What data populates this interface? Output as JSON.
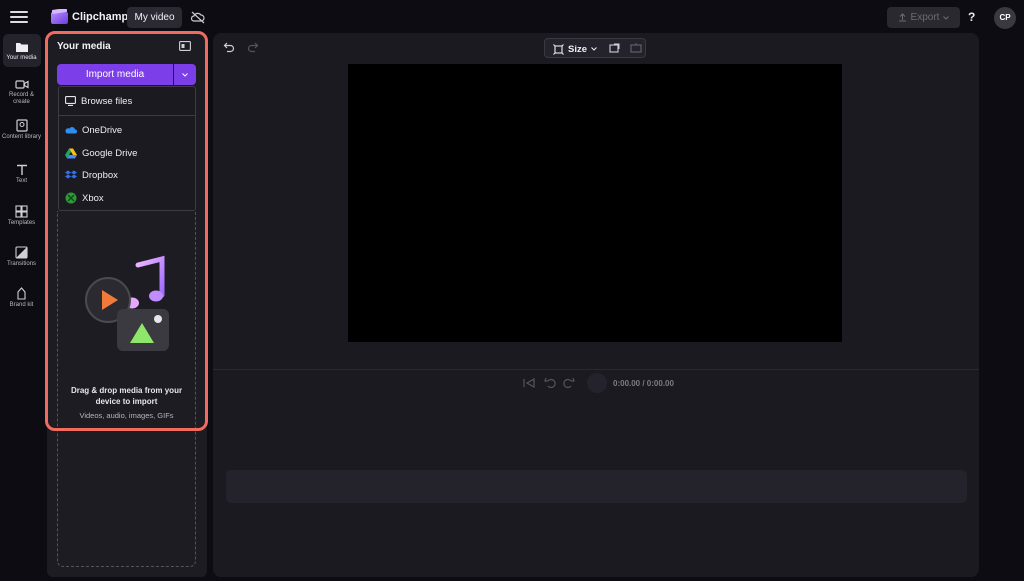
{
  "app": {
    "name": "Clipchamp",
    "project_name": "My video"
  },
  "header": {
    "export_label": "Export",
    "help_label": "?",
    "avatar_initials": "CP"
  },
  "rail": {
    "items": [
      {
        "label": "Your media",
        "icon": "folder-icon"
      },
      {
        "label": "Record & create",
        "icon": "video-camera-icon"
      },
      {
        "label": "Content library",
        "icon": "content-library-icon"
      },
      {
        "label": "Text",
        "icon": "text-icon"
      },
      {
        "label": "Templates",
        "icon": "templates-icon"
      },
      {
        "label": "Transitions",
        "icon": "transitions-icon"
      },
      {
        "label": "Brand kit",
        "icon": "brand-kit-icon"
      }
    ]
  },
  "media_panel": {
    "title": "Your media",
    "import_label": "Import media",
    "dropdown": {
      "browse": "Browse files",
      "sources": [
        "OneDrive",
        "Google Drive",
        "Dropbox",
        "Xbox"
      ]
    },
    "drop_title": "Drag & drop media from your device to import",
    "drop_subtitle": "Videos, audio, images, GIFs"
  },
  "toolbar": {
    "size_label": "Size"
  },
  "playback": {
    "time": "0:00.00 / 0:00.00"
  },
  "colors": {
    "accent": "#7c3ee8",
    "highlight": "#f26b5f",
    "background": "#0d0c12"
  }
}
